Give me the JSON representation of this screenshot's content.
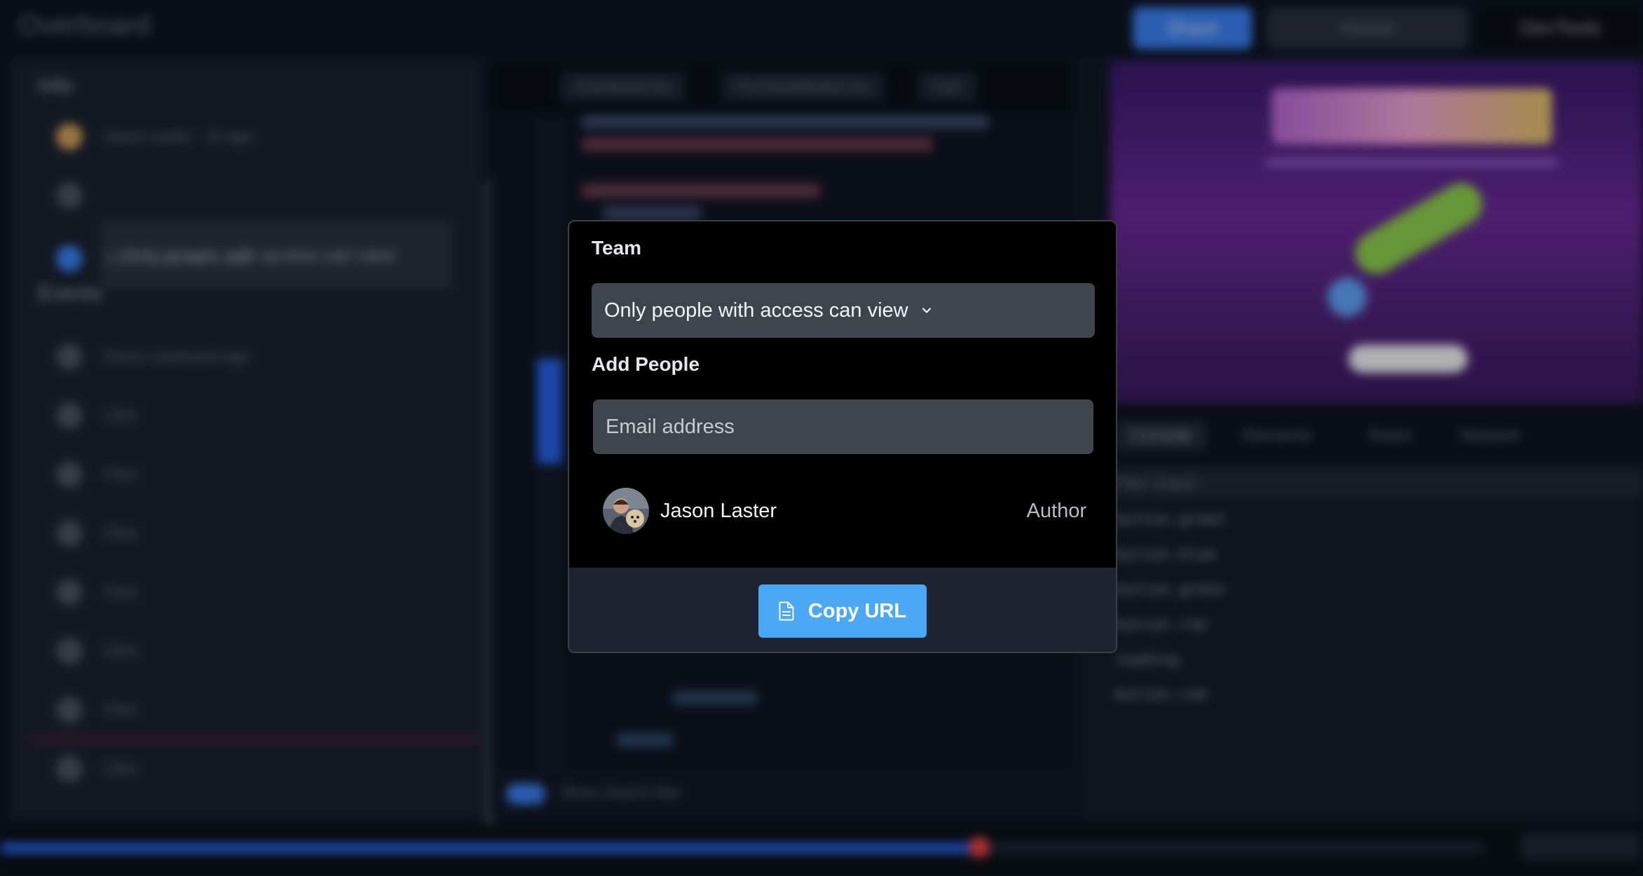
{
  "app": {
    "title": "Overboard"
  },
  "header": {
    "share_label": "Share",
    "viewer_label": "Viewer",
    "devtools_label": "DevTools"
  },
  "sidebar": {
    "info_label": "Info",
    "events_label": "Events",
    "author_row": "Jason Laster · 1h ago",
    "privacy_pill": "Only people with access can view",
    "recording_name": "Demo overboard app",
    "events": [
      "Demo overboard app",
      "Click",
      "Click",
      "Click",
      "Click",
      "Click",
      "Click",
      "Click"
    ]
  },
  "editor": {
    "tabs": [
      "Overboard.tsx",
      "PurchaseButton.tsx",
      "Cart"
    ],
    "footer_label": "Show Search Bar"
  },
  "devtools": {
    "tabs": [
      "Console",
      "Elements",
      "React",
      "Network"
    ],
    "filter_placeholder": "Filter output",
    "rows": [
      "button.green",
      "button.blue",
      "button.green",
      "button.red",
      "loading",
      "button.red"
    ]
  },
  "modal": {
    "team_label": "Team",
    "privacy_option": "Only people with access can view",
    "add_people_label": "Add People",
    "email_placeholder": "Email address",
    "people": [
      {
        "name": "Jason Laster",
        "role": "Author"
      }
    ],
    "copy_button": "Copy URL"
  },
  "icons": {
    "chevron": "chevron-down-icon",
    "copy": "document-icon"
  },
  "colors": {
    "accent": "#4aa8f5",
    "modal_bg": "#000000",
    "input_bg": "#3f444d",
    "footer_bg": "#1d2330"
  }
}
